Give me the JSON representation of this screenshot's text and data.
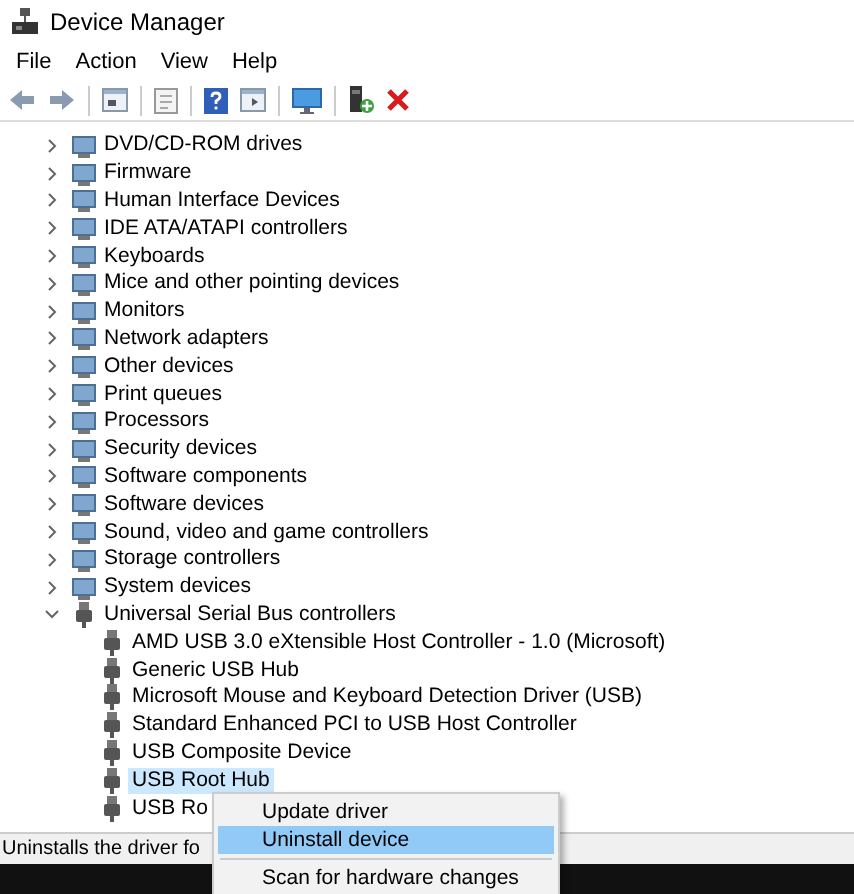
{
  "window": {
    "title": "Device Manager"
  },
  "menu_bar": [
    "File",
    "Action",
    "View",
    "Help"
  ],
  "tree": [
    {
      "label": "DVD/CD-ROM drives",
      "expanded": false,
      "selected": false
    },
    {
      "label": "Firmware",
      "expanded": false,
      "selected": false
    },
    {
      "label": "Human Interface Devices",
      "expanded": false,
      "selected": false
    },
    {
      "label": "IDE ATA/ATAPI controllers",
      "expanded": false,
      "selected": false
    },
    {
      "label": "Keyboards",
      "expanded": false,
      "selected": false
    },
    {
      "label": "Mice and other pointing devices",
      "expanded": false,
      "selected": false
    },
    {
      "label": "Monitors",
      "expanded": false,
      "selected": false
    },
    {
      "label": "Network adapters",
      "expanded": false,
      "selected": false
    },
    {
      "label": "Other devices",
      "expanded": false,
      "selected": false
    },
    {
      "label": "Print queues",
      "expanded": false,
      "selected": false
    },
    {
      "label": "Processors",
      "expanded": false,
      "selected": false
    },
    {
      "label": "Security devices",
      "expanded": false,
      "selected": false
    },
    {
      "label": "Software components",
      "expanded": false,
      "selected": false
    },
    {
      "label": "Software devices",
      "expanded": false,
      "selected": false
    },
    {
      "label": "Sound, video and game controllers",
      "expanded": false,
      "selected": false
    },
    {
      "label": "Storage controllers",
      "expanded": false,
      "selected": false
    },
    {
      "label": "System devices",
      "expanded": false,
      "selected": false
    },
    {
      "label": "Universal Serial Bus controllers",
      "expanded": true,
      "selected": false,
      "children": [
        {
          "label": "AMD USB 3.0 eXtensible Host Controller - 1.0 (Microsoft)",
          "selected": false
        },
        {
          "label": "Generic USB Hub",
          "selected": false
        },
        {
          "label": "Microsoft Mouse and Keyboard Detection Driver (USB)",
          "selected": false
        },
        {
          "label": "Standard Enhanced PCI to USB Host Controller",
          "selected": false
        },
        {
          "label": "USB Composite Device",
          "selected": false
        },
        {
          "label": "USB Root Hub",
          "selected": true
        },
        {
          "label": "USB Ro",
          "selected": false
        }
      ]
    }
  ],
  "context_menu": [
    {
      "kind": "item",
      "label": "Update driver",
      "selected": false
    },
    {
      "kind": "item",
      "label": "Uninstall device",
      "selected": true
    },
    {
      "kind": "separator"
    },
    {
      "kind": "item",
      "label": "Scan for hardware changes",
      "selected": false
    }
  ],
  "status_bar": "Uninstalls the driver fo"
}
